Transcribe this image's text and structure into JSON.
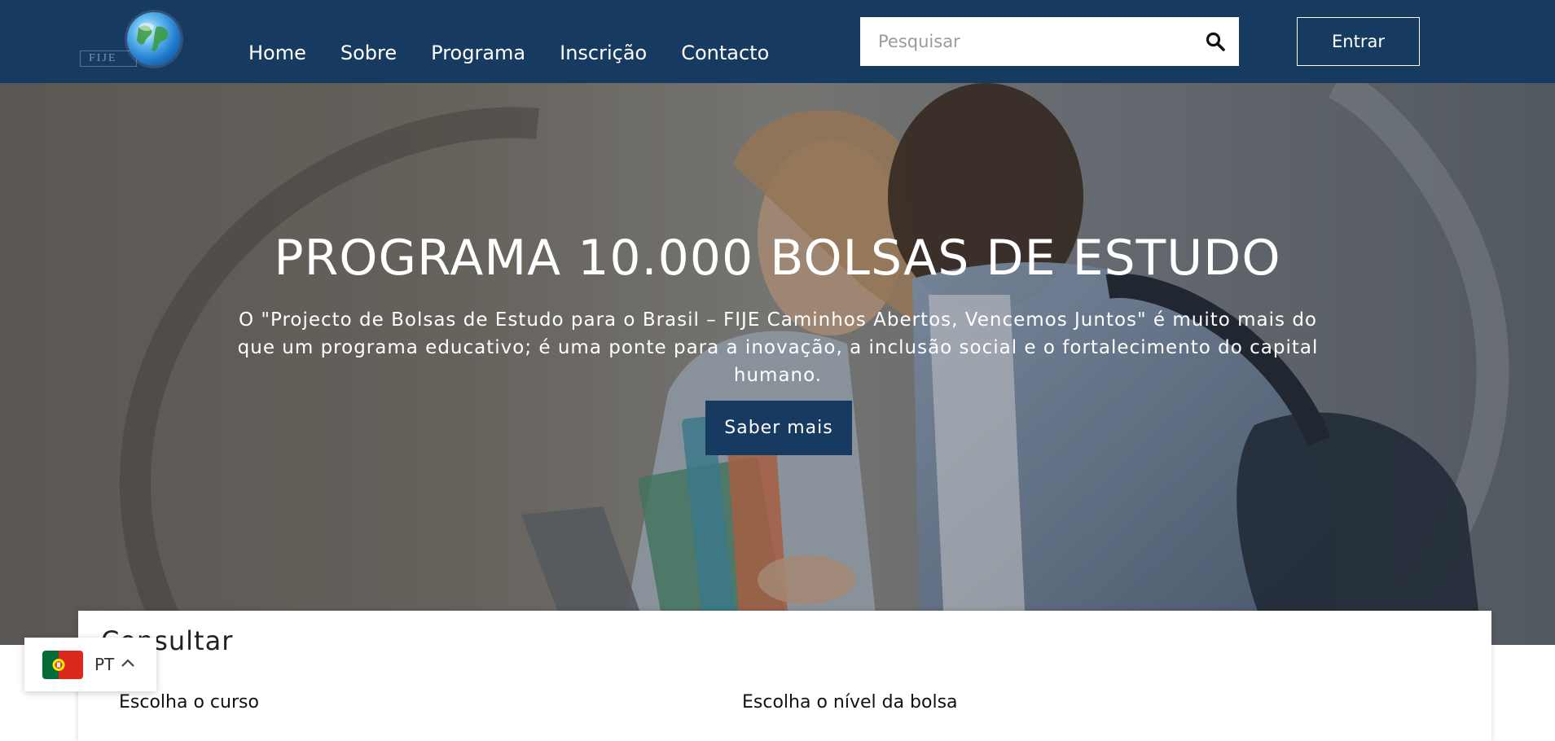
{
  "header": {
    "logo_text": "FIJE",
    "nav": [
      "Home",
      "Sobre",
      "Programa",
      "Inscrição",
      "Contacto"
    ],
    "search_placeholder": "Pesquisar",
    "login_label": "Entrar",
    "bg_color": "#173a61"
  },
  "hero": {
    "title": "PROGRAMA 10.000 BOLSAS DE ESTUDO",
    "text": "O \"Projecto de Bolsas de Estudo para o Brasil – FIJE Caminhos Abertos, Vencemos Juntos\" é muito mais do que um programa educativo; é uma ponte para a inovação, a inclusão social e o fortalecimento do capital humano.",
    "button_label": "Saber mais"
  },
  "consult": {
    "title": "Consultar",
    "course_label": "Escolha o curso",
    "level_label": "Escolha o nível da bolsa"
  },
  "language": {
    "code": "PT",
    "flag": "portugal-flag"
  },
  "icons": {
    "search": "search-icon",
    "chevron": "chevron-up-icon",
    "logo": "globe-icon"
  }
}
